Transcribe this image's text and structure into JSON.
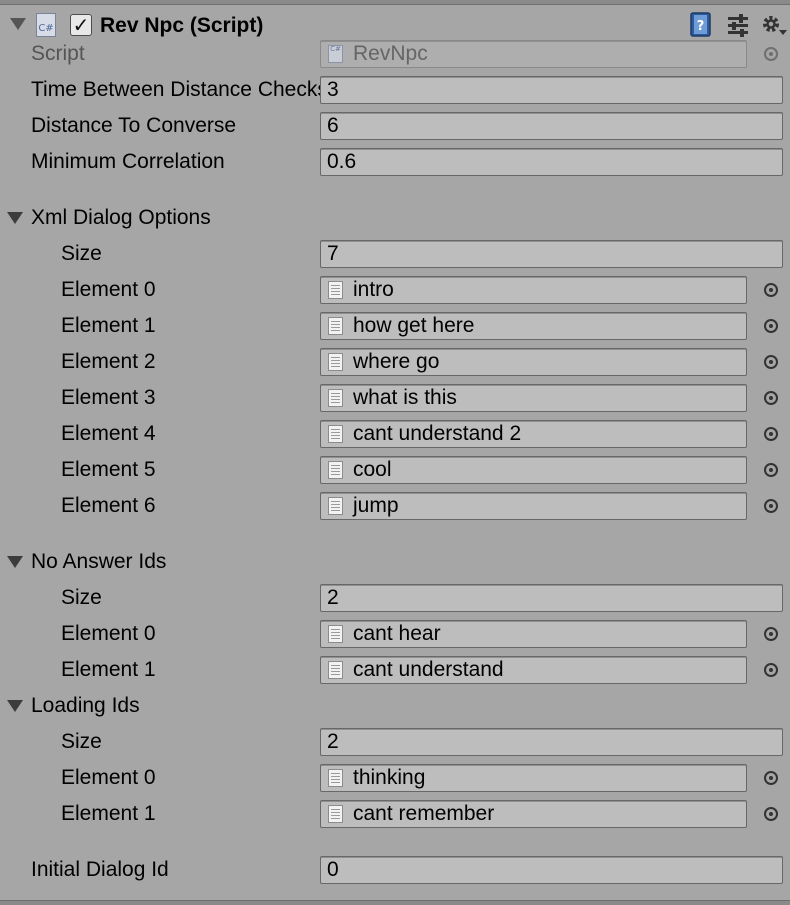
{
  "component": {
    "title": "Rev Npc (Script)",
    "enabled": true,
    "icons": [
      "help-book-icon",
      "presets-sliders-icon",
      "gear-menu-icon"
    ]
  },
  "fields": {
    "script": {
      "label": "Script",
      "value": "RevNpc"
    },
    "time_between": {
      "label": "Time Between Distance Checks",
      "value": "3"
    },
    "distance": {
      "label": "Distance To Converse",
      "value": "6"
    },
    "min_corr": {
      "label": "Minimum Correlation",
      "value": "0.6"
    },
    "initial_dialog": {
      "label": "Initial Dialog Id",
      "value": "0"
    }
  },
  "xml_dialog_options": {
    "label": "Xml Dialog Options",
    "size_label": "Size",
    "size": "7",
    "elements": [
      {
        "label": "Element 0",
        "value": "intro"
      },
      {
        "label": "Element 1",
        "value": "how get here"
      },
      {
        "label": "Element 2",
        "value": "where go"
      },
      {
        "label": "Element 3",
        "value": "what is this"
      },
      {
        "label": "Element 4",
        "value": "cant understand 2"
      },
      {
        "label": "Element 5",
        "value": "cool"
      },
      {
        "label": "Element 6",
        "value": "jump"
      }
    ]
  },
  "no_answer_ids": {
    "label": "No Answer Ids",
    "size_label": "Size",
    "size": "2",
    "elements": [
      {
        "label": "Element 0",
        "value": "cant hear"
      },
      {
        "label": "Element 1",
        "value": "cant understand"
      }
    ]
  },
  "loading_ids": {
    "label": "Loading Ids",
    "size_label": "Size",
    "size": "2",
    "elements": [
      {
        "label": "Element 0",
        "value": "thinking"
      },
      {
        "label": "Element 1",
        "value": "cant remember"
      }
    ]
  }
}
